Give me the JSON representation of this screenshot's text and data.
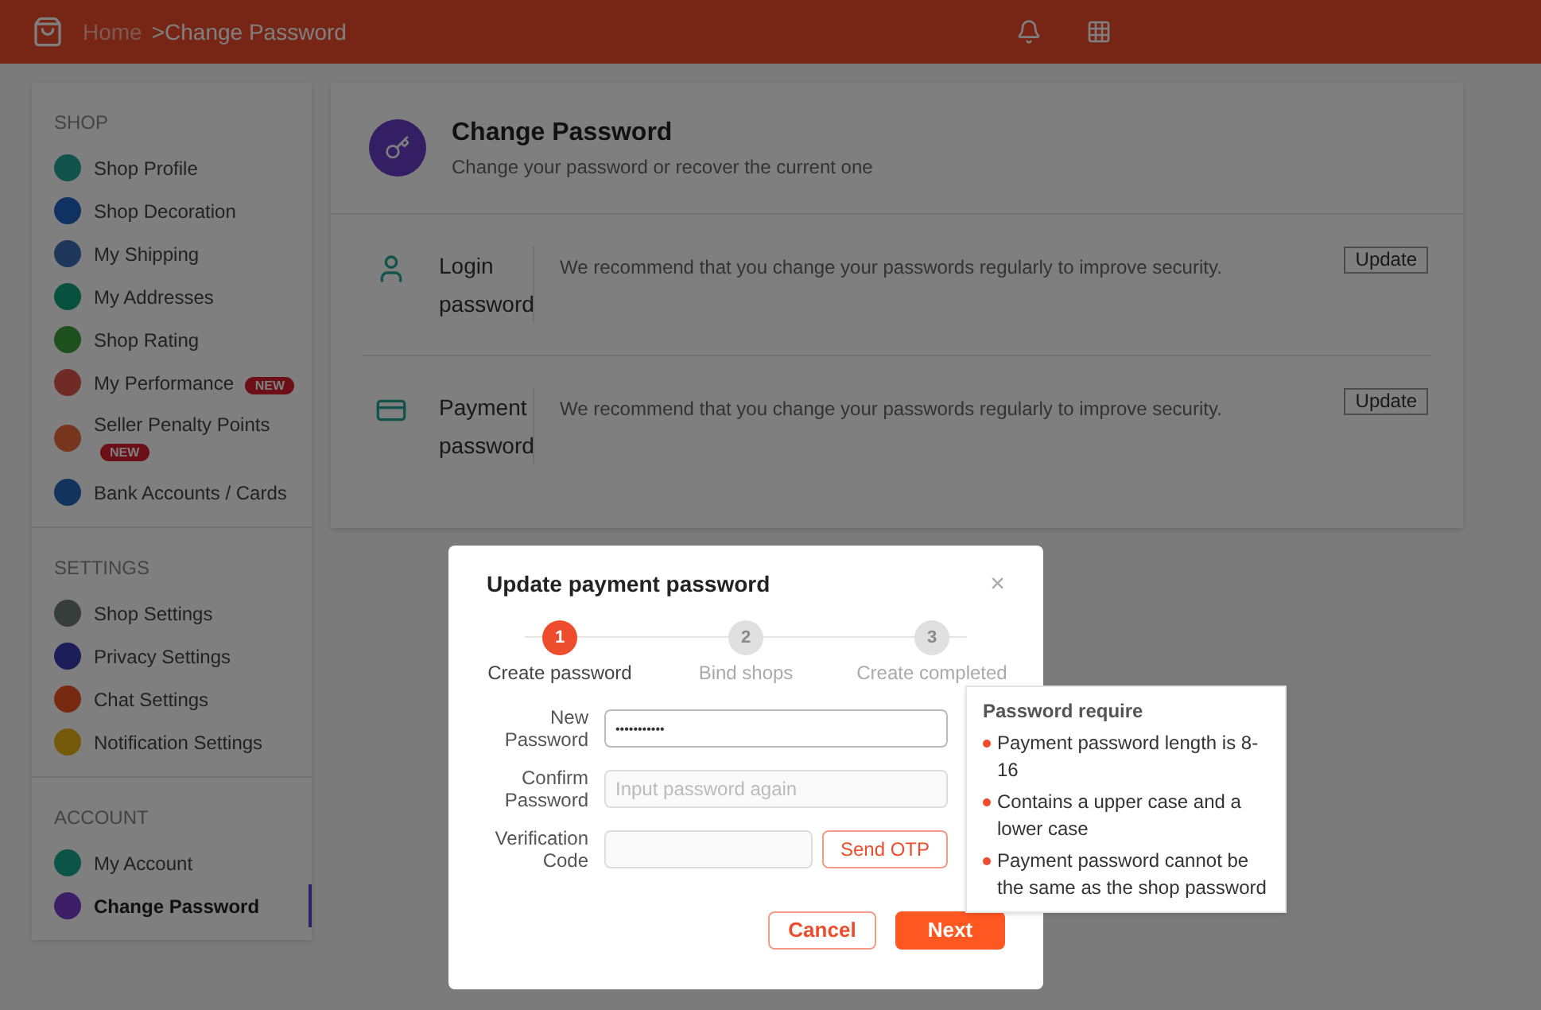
{
  "header": {
    "breadcrumb_home": "Home",
    "breadcrumb_current": ">Change Password"
  },
  "sidebar": {
    "sections": [
      {
        "title": "SHOP",
        "items": [
          {
            "label": "Shop Profile",
            "color": "#13534d",
            "selected": false
          },
          {
            "label": "Shop Decoration",
            "color": "#0f3262",
            "selected": false
          },
          {
            "label": "My Shipping",
            "color": "#1f375a",
            "selected": false
          },
          {
            "label": "My Addresses",
            "color": "#08513f",
            "selected": false
          },
          {
            "label": "Shop Rating",
            "color": "#1d501d",
            "selected": false
          },
          {
            "label": "My Performance",
            "color": "#702b27",
            "selected": false,
            "badge": "NEW"
          },
          {
            "label": "Seller Penalty Points",
            "color": "#77351e",
            "selected": false,
            "badge": "NEW"
          },
          {
            "label": "Bank Accounts / Cards",
            "color": "#12335c",
            "selected": false
          }
        ]
      },
      {
        "title": "SETTINGS",
        "items": [
          {
            "label": "Shop Settings",
            "color": "#363d3a",
            "selected": false
          },
          {
            "label": "Privacy Settings",
            "color": "#1d1d5a",
            "selected": false
          },
          {
            "label": "Chat Settings",
            "color": "#772a11",
            "selected": false
          },
          {
            "label": "Notification Settings",
            "color": "#74590a",
            "selected": false
          }
        ]
      },
      {
        "title": "ACCOUNT",
        "items": [
          {
            "label": "My Account",
            "color": "#0c5445",
            "selected": false
          },
          {
            "label": "Change Password",
            "color": "#3d1f68",
            "selected": true
          }
        ]
      }
    ]
  },
  "main": {
    "title": "Change Password",
    "subtitle": "Change your password or recover the current one",
    "rows": [
      {
        "kind": "login",
        "label": "Login password",
        "description": "We recommend that you change your passwords regularly to improve security.",
        "button": "Update"
      },
      {
        "kind": "payment",
        "label": "Payment password",
        "description": "We recommend that you change your passwords regularly to improve security.",
        "button": "Update"
      }
    ]
  },
  "dialog": {
    "title": "Update payment password",
    "close": "×",
    "steps": [
      {
        "number": "1",
        "label": "Create password",
        "selected": true
      },
      {
        "number": "2",
        "label": "Bind shops",
        "selected": false
      },
      {
        "number": "3",
        "label": "Create completed",
        "selected": false
      }
    ],
    "fields": [
      {
        "kind": "password",
        "label": "New Password",
        "value": "•••••••••••"
      },
      {
        "kind": "text",
        "label": "Confirm Password",
        "placeholder": "Input password again"
      },
      {
        "kind": "otp",
        "label": "Verification Code",
        "button": "Send OTP"
      }
    ],
    "buttons": {
      "cancel": "Cancel",
      "next": "Next"
    },
    "tooltip": {
      "title": "Password require",
      "items": [
        "Payment password length is 8-16",
        "Contains a upper case and a lower case",
        "Payment password cannot be the same as the shop password"
      ]
    }
  }
}
